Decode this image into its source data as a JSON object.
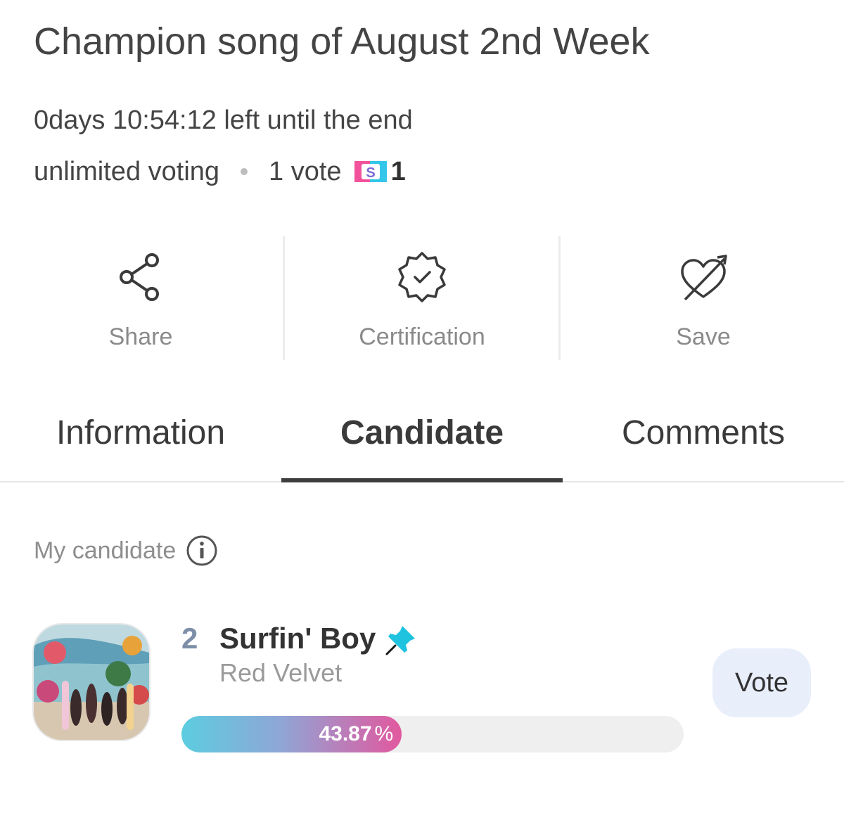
{
  "header": {
    "title": "Champion song of August 2nd Week",
    "countdown": "0days 10:54:12 left until the end",
    "voting_type": "unlimited voting",
    "vote_cost": "1 vote",
    "coin_icon": "s-coin-icon",
    "coin_count": "1"
  },
  "actions": [
    {
      "label": "Share",
      "icon": "share-icon"
    },
    {
      "label": "Certification",
      "icon": "certification-badge-icon"
    },
    {
      "label": "Save",
      "icon": "heart-arrow-icon"
    }
  ],
  "tabs": [
    {
      "label": "Information",
      "active": false
    },
    {
      "label": "Candidate",
      "active": true
    },
    {
      "label": "Comments",
      "active": false
    }
  ],
  "my_candidate": {
    "heading": "My candidate",
    "info_icon": "info-icon",
    "rank": "2",
    "song": "Surfin' Boy",
    "artist": "Red Velvet",
    "pin_icon": "pin-icon",
    "vote_label": "Vote",
    "percent_value": "43.87",
    "percent_unit": "%",
    "percent_fraction": 0.4387
  },
  "colors": {
    "bar_start": "#5ccde0",
    "bar_end": "#e2589e",
    "vote_button_bg": "#e9eefb",
    "pin": "#1fc3e0"
  }
}
